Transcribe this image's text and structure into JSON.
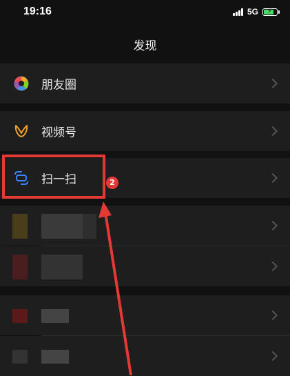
{
  "status_bar": {
    "time": "19:16",
    "network": "5G"
  },
  "header": {
    "title": "发现"
  },
  "menu": {
    "moments": "朋友圈",
    "channels": "视频号",
    "scan": "扫一扫"
  },
  "annotation": {
    "badge": "2"
  },
  "colors": {
    "highlight": "#e53935",
    "battery": "#4cd964"
  }
}
